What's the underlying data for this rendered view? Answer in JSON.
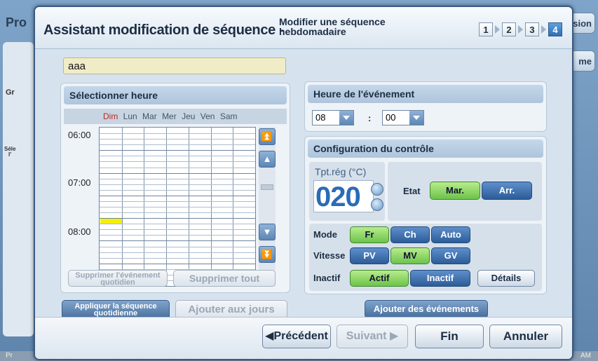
{
  "background": {
    "title_fragment": "Pro",
    "btn_top_fragment": "sion",
    "btn_second_fragment": "me",
    "side_text_1": "Gr",
    "side_text_2": "Séle",
    "side_text_3": "l'",
    "status_left": "Pr",
    "status_right": "AM"
  },
  "dialog": {
    "title": "Assistant modification de séquence -",
    "subtitle": "Modifier une séquence hebdomadaire",
    "steps": [
      "1",
      "2",
      "3",
      "4"
    ],
    "active_step": 4
  },
  "name_field": {
    "value": "aaa"
  },
  "schedule": {
    "header": "Sélectionner heure",
    "days": [
      "Dim",
      "Lun",
      "Mar",
      "Mer",
      "Jeu",
      "Ven",
      "Sam"
    ],
    "times": [
      "06:00",
      "07:00",
      "08:00"
    ],
    "btn_delete_daily": "Supprimer l'événement quotidien",
    "btn_delete_all": "Supprimer tout"
  },
  "apply_daily": "Appliquer la séquence quotidienne",
  "add_to_days": "Ajouter aux jours",
  "event_time": {
    "header": "Heure de l'événement",
    "hour": "08",
    "minute": "00",
    "separator": ":"
  },
  "control": {
    "header": "Configuration du contrôle",
    "setpoint_label": "Tpt.rég (°C)",
    "setpoint_value": "020",
    "state_label": "Etat",
    "state_on": "Mar.",
    "state_off": "Arr.",
    "mode_label": "Mode",
    "mode_options": [
      "Fr",
      "Ch",
      "Auto"
    ],
    "speed_label": "Vitesse",
    "speed_options": [
      "PV",
      "MV",
      "GV"
    ],
    "idle_label": "Inactif",
    "idle_options": [
      "Actif",
      "Inactif"
    ],
    "details": "Détails"
  },
  "add_events": "Ajouter des événements",
  "footer": {
    "previous": "Précédent",
    "next": "Suivant",
    "finish": "Fin",
    "cancel": "Annuler"
  },
  "colors": {
    "accent_blue": "#2f6fb5",
    "selected_green": "#6cc34a",
    "highlight_cell": "#f4f000",
    "sunday_red": "#c0281f"
  }
}
